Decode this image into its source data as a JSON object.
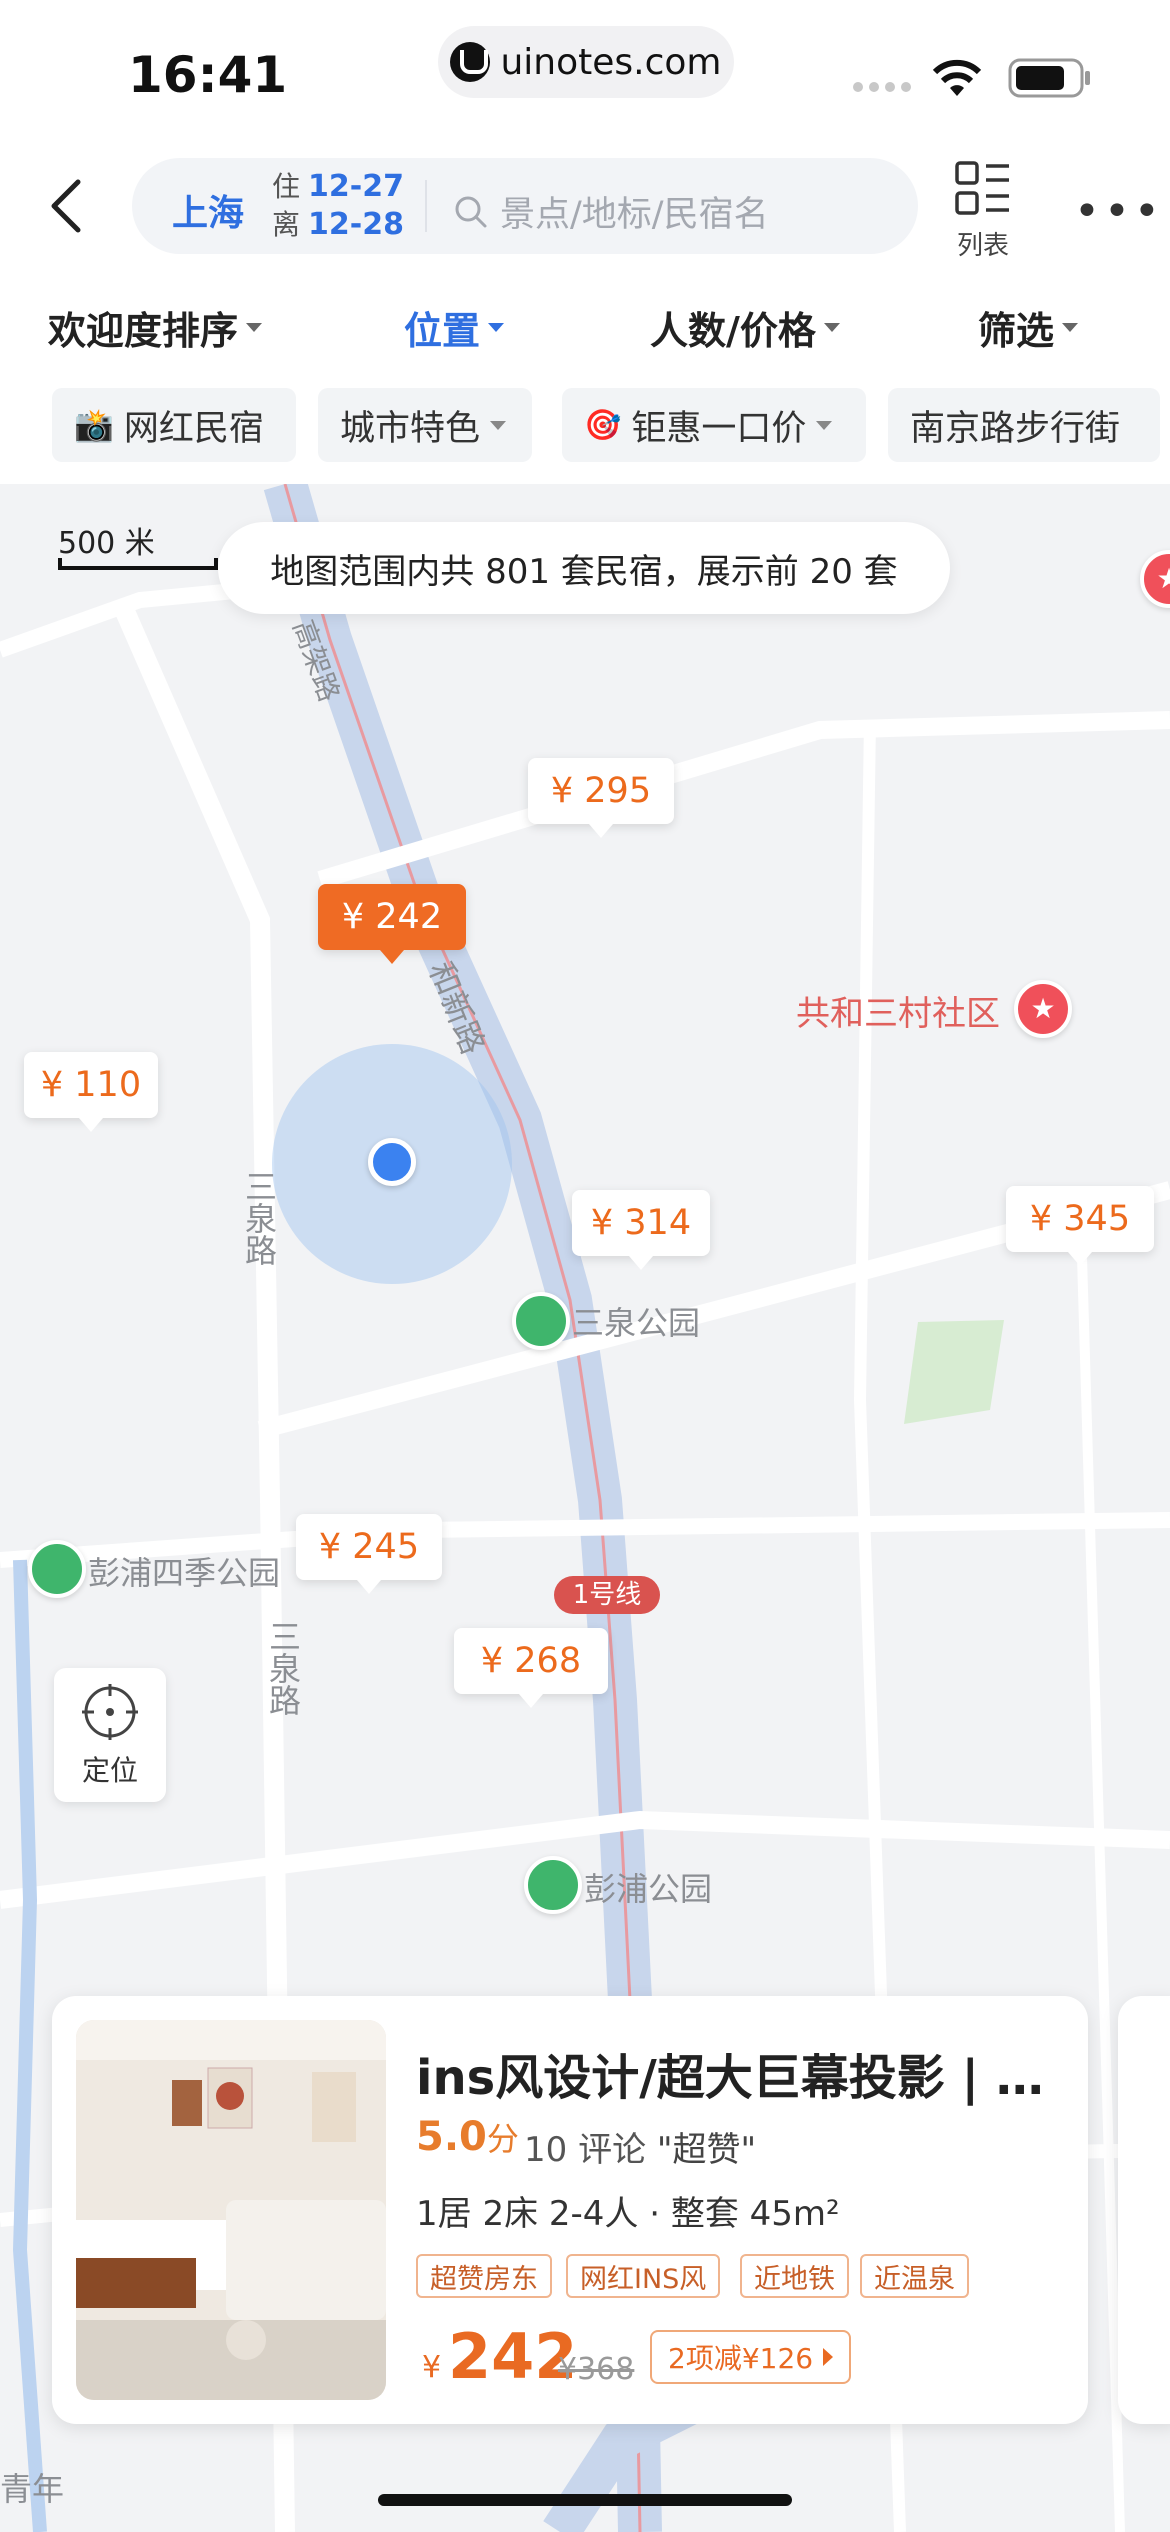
{
  "status_bar": {
    "time": "16:41",
    "url": "uinotes.com",
    "icons": [
      "signal-dots-icon",
      "wifi-icon",
      "battery-icon"
    ]
  },
  "header": {
    "city": "上海",
    "checkin_label": "住",
    "checkin_date": "12-27",
    "checkout_label": "离",
    "checkout_date": "12-28",
    "search_placeholder": "景点/地标/民宿名",
    "list_label": "列表",
    "more_icon": "more-icon"
  },
  "sort_bar": [
    {
      "label": "欢迎度排序",
      "active": false
    },
    {
      "label": "位置",
      "active": true
    },
    {
      "label": "人数/价格",
      "active": false
    },
    {
      "label": "筛选",
      "active": false
    }
  ],
  "chips": [
    {
      "label": "网红民宿",
      "icon": "camera-icon"
    },
    {
      "label": "城市特色",
      "icon": ""
    },
    {
      "label": "钜惠一口价",
      "icon": "target-icon"
    },
    {
      "label": "南京路步行街",
      "icon": ""
    }
  ],
  "map": {
    "scale_label": "500 米",
    "banner": "地图范围内共 801 套民宿，展示前 20 套",
    "price_markers": [
      "¥ 295",
      "¥ 242",
      "¥ 110",
      "¥ 314",
      "¥ 345",
      "¥ 245",
      "¥ 268"
    ],
    "selected_price": "¥ 242",
    "labels": {
      "poi_gonghe": "共和三村社区",
      "poi_sanquan_park": "三泉公园",
      "poi_pengpu_siji": "彭浦四季公园",
      "poi_pengpu_park": "彭浦公园",
      "road_gonghexin": "和新路",
      "road_elevated": "高架路",
      "road_sanquan_1": "三泉路",
      "road_sanquan_2": "三泉路",
      "metro_line": "1号线",
      "edge_bottom_left": "青年"
    },
    "locate_label": "定位"
  },
  "listing": {
    "title": "ins风设计/超大巨幕投影 | 近地铁 | 南京路",
    "rating": "5.0",
    "rating_unit": "分",
    "reviews": "10 评论",
    "review_tag": "\"超赞\"",
    "room_info": "1居 2床 2-4人 · 整套 45m²",
    "tags": [
      "超赞房东",
      "网红INS风",
      "近地铁",
      "近温泉"
    ],
    "currency": "¥",
    "price": "242",
    "original_price": "¥368",
    "promo": "2项减¥126"
  },
  "colors": {
    "accent_blue": "#2f6fe0",
    "price_orange": "#ec6a1c",
    "map_bg": "#f2f3f5"
  }
}
